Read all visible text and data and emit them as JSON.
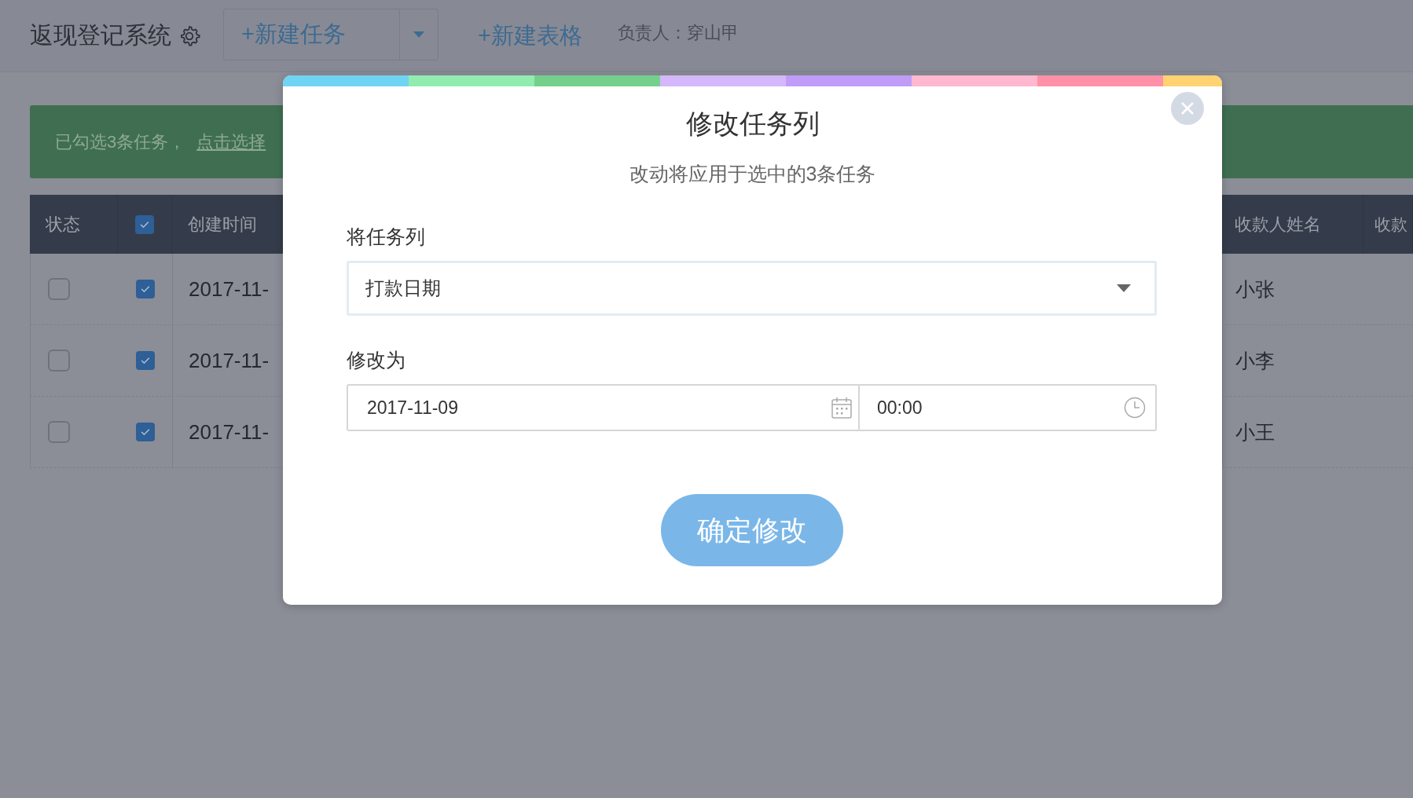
{
  "header": {
    "app_title": "返现登记系统",
    "new_task_button": "+新建任务",
    "new_sheet_button": "+新建表格",
    "owner": "负责人：穿山甲"
  },
  "banner": {
    "text": "已勾选3条任务，",
    "link": "点击选择"
  },
  "table": {
    "columns": [
      {
        "kind": "text",
        "label": "状态"
      },
      {
        "kind": "checkbox",
        "checked": true
      },
      {
        "kind": "text",
        "label": "创建时间"
      },
      {
        "kind": "text",
        "label": "收款人姓名"
      },
      {
        "kind": "text",
        "label": "收款"
      }
    ],
    "rows": [
      {
        "status_checked": false,
        "selected": true,
        "created": "2017-11-",
        "payee": "小张"
      },
      {
        "status_checked": false,
        "selected": true,
        "created": "2017-11-",
        "payee": "小李"
      },
      {
        "status_checked": false,
        "selected": true,
        "created": "2017-11-",
        "payee": "小王"
      }
    ]
  },
  "dialog": {
    "title": "修改任务列",
    "subtitle": "改动将应用于选中的3条任务",
    "column_label": "将任务列",
    "column_value": "打款日期",
    "new_value_label": "修改为",
    "date_value": "2017-11-09",
    "time_value": "00:00",
    "confirm_button": "确定修改"
  }
}
